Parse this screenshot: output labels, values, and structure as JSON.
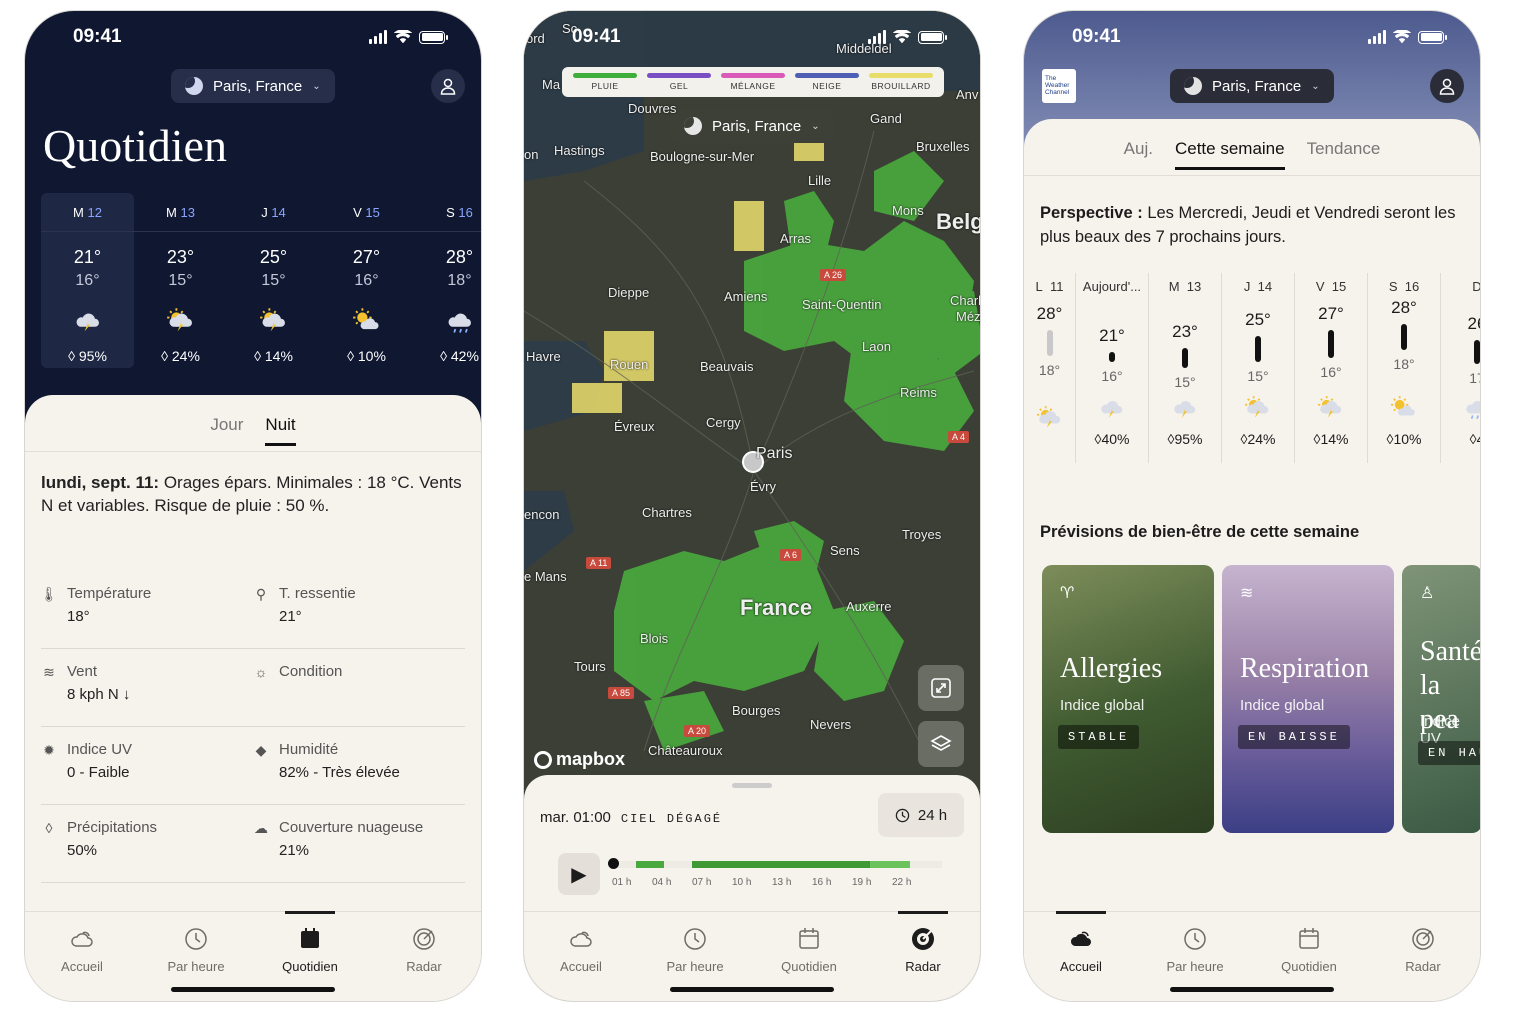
{
  "status": {
    "time": "09:41"
  },
  "phone1": {
    "location": "Paris, France",
    "title": "Quotidien",
    "days": [
      {
        "dow": "M",
        "num": "12",
        "hi": "21°",
        "lo": "16°",
        "icon": "thunderstorm-icon",
        "precip": "95%"
      },
      {
        "dow": "M",
        "num": "13",
        "hi": "23°",
        "lo": "15°",
        "icon": "partly-sunny-storm-icon",
        "precip": "24%"
      },
      {
        "dow": "J",
        "num": "14",
        "hi": "25°",
        "lo": "15°",
        "icon": "partly-sunny-storm-icon",
        "precip": "14%"
      },
      {
        "dow": "V",
        "num": "15",
        "hi": "27°",
        "lo": "16°",
        "icon": "sun-cloud-icon",
        "precip": "10%"
      },
      {
        "dow": "S",
        "num": "16",
        "hi": "28°",
        "lo": "18°",
        "icon": "rain-cloud-icon",
        "precip": "42%"
      }
    ],
    "segments": [
      "Jour",
      "Nuit"
    ],
    "summary_date": "lundi, sept. 11:",
    "summary_text": " Orages épars. Minimales : 18 °C. Vents N et variables. Risque de pluie : 50 %.",
    "details": [
      {
        "icon": "thermometer-icon",
        "label": "Température",
        "value": "18°"
      },
      {
        "icon": "feels-like-icon",
        "label": "T. ressentie",
        "value": "21°"
      },
      {
        "icon": "wind-icon",
        "label": "Vent",
        "value": "8 kph N  ↓"
      },
      {
        "icon": "condition-icon",
        "label": "Condition",
        "value": ""
      },
      {
        "icon": "uv-icon",
        "label": "Indice UV",
        "value": "0 - Faible"
      },
      {
        "icon": "humidity-icon",
        "label": "Humidité",
        "value": "82% - Très élevée"
      },
      {
        "icon": "drop-icon",
        "label": "Précipitations",
        "value": "50%"
      },
      {
        "icon": "cloud-icon",
        "label": "Couverture nuageuse",
        "value": "21%"
      }
    ]
  },
  "phone2": {
    "location": "Paris, France",
    "legend": [
      {
        "label": "PLUIE",
        "color": "#3fae3a"
      },
      {
        "label": "GEL",
        "color": "#7a4fc4"
      },
      {
        "label": "MÉLANGE",
        "color": "#d95ab8"
      },
      {
        "label": "NEIGE",
        "color": "#4f5fb4"
      },
      {
        "label": "BROUILLARD",
        "color": "#e8dc6a"
      }
    ],
    "cities": [
      "Middeldel",
      "Douvres",
      "Hastings",
      "Boulogne-sur-Mer",
      "Gand",
      "Bruxelles",
      "Lille",
      "Mons",
      "Belgi",
      "Arras",
      "Dieppe",
      "Amiens",
      "Saint-Quentin",
      "Charl",
      "Méz",
      "Havre",
      "Rouen",
      "Beauvais",
      "Laon",
      "Reims",
      "Évreux",
      "Cergy",
      "Paris",
      "Évry",
      "Chartres",
      "Troyes",
      "Sens",
      "e Mans",
      "France",
      "Auxerre",
      "Blois",
      "Tours",
      "Bourges",
      "Nevers",
      "Châteauroux",
      "encon",
      "Ma",
      "on",
      "ord",
      "Sc",
      "Anv"
    ],
    "roads": [
      "A 26",
      "A 4",
      "A 6",
      "A 11",
      "A 85",
      "A 20"
    ],
    "attribution": "mapbox",
    "time": "mar. 01:00",
    "condition": "CIEL DÉGAGÉ",
    "range": "24 h",
    "ticks": [
      "01 h",
      "04 h",
      "07 h",
      "10 h",
      "13 h",
      "16 h",
      "19 h",
      "22 h"
    ]
  },
  "phone3": {
    "logo": "The Weather Channel",
    "location": "Paris, France",
    "segments": [
      "Auj.",
      "Cette semaine",
      "Tendance"
    ],
    "perspective_label": "Perspective :",
    "perspective_text": " Les Mercredi, Jeudi et Vendredi seront les plus beaux des 7 prochains jours.",
    "week": [
      {
        "dow": "L",
        "num": "11",
        "hi": "28°",
        "lo": "18°",
        "precip": ""
      },
      {
        "dow": "Aujourd'...",
        "num": "",
        "hi": "21°",
        "lo": "16°",
        "precip": "40%"
      },
      {
        "dow": "M",
        "num": "13",
        "hi": "23°",
        "lo": "15°",
        "precip": "95%"
      },
      {
        "dow": "J",
        "num": "14",
        "hi": "25°",
        "lo": "15°",
        "precip": "24%"
      },
      {
        "dow": "V",
        "num": "15",
        "hi": "27°",
        "lo": "16°",
        "precip": "14%"
      },
      {
        "dow": "S",
        "num": "16",
        "hi": "28°",
        "lo": "18°",
        "precip": "10%"
      },
      {
        "dow": "D",
        "num": "",
        "hi": "26",
        "lo": "17",
        "precip": "4"
      }
    ],
    "wellness_title": "Prévisions de bien-être de cette semaine",
    "cards": [
      {
        "title": "Allergies",
        "sub": "Indice global",
        "badge": "STABLE"
      },
      {
        "title": "Respiration",
        "sub": "Indice global",
        "badge": "EN BAISSE"
      },
      {
        "title": "Santé la pea",
        "sub": "Indice UV",
        "badge": "EN HAU"
      }
    ]
  },
  "tabs": [
    "Accueil",
    "Par heure",
    "Quotidien",
    "Radar"
  ]
}
